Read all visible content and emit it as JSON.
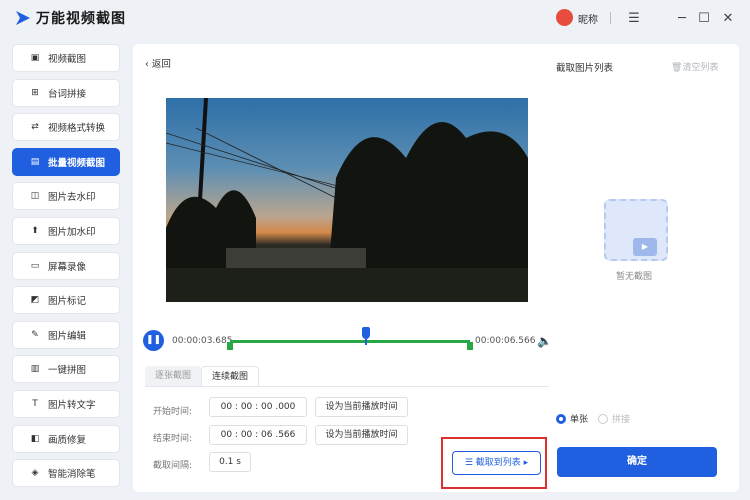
{
  "app": {
    "title": "万能视频截图",
    "user": "昵称",
    "avatar_text": ""
  },
  "window_controls": [
    "☰",
    "─",
    "☐",
    "✕"
  ],
  "sidebar": {
    "items": [
      {
        "label": "视频截图",
        "icon": "image-icon",
        "glyph": "▣",
        "active": false
      },
      {
        "label": "台词拼接",
        "icon": "dialogue-icon",
        "glyph": "⊞",
        "active": false
      },
      {
        "label": "视频格式转换",
        "icon": "convert-icon",
        "glyph": "⇄",
        "active": false
      },
      {
        "label": "批量视频截图",
        "icon": "batch-icon",
        "glyph": "▤",
        "active": true
      },
      {
        "label": "图片去水印",
        "icon": "remove-watermark-icon",
        "glyph": "◫",
        "active": false
      },
      {
        "label": "图片加水印",
        "icon": "add-watermark-icon",
        "glyph": "⬆",
        "active": false
      },
      {
        "label": "屏幕录像",
        "icon": "screen-record-icon",
        "glyph": "▭",
        "active": false
      },
      {
        "label": "图片标记",
        "icon": "mark-icon",
        "glyph": "◩",
        "active": false
      },
      {
        "label": "图片编辑",
        "icon": "edit-icon",
        "glyph": "✎",
        "active": false
      },
      {
        "label": "一键拼图",
        "icon": "collage-icon",
        "glyph": "▥",
        "active": false
      },
      {
        "label": "图片转文字",
        "icon": "text-icon",
        "glyph": "T",
        "active": false
      },
      {
        "label": "画质修复",
        "icon": "restore-icon",
        "glyph": "◧",
        "active": false
      },
      {
        "label": "智能消除笔",
        "icon": "eraser-icon",
        "glyph": "◈",
        "active": false
      }
    ]
  },
  "main": {
    "back_label": "返回",
    "list_title": "截取图片列表",
    "clear_list": "清空列表",
    "empty_text": "暂无截图",
    "player": {
      "current_time": "00:00:03.685",
      "end_time": "00:00:06.566"
    },
    "tabs": [
      {
        "label": "逐张截图",
        "active": false
      },
      {
        "label": "连续截图",
        "active": true
      }
    ],
    "form": {
      "start_label": "开始时间:",
      "start_value": "00 : 00 : 00 .000",
      "end_label": "结束时间:",
      "end_value": "00 : 00 : 06 .566",
      "interval_label": "截取间隔:",
      "interval_value": "0.1  s",
      "set_current_label": "设为当前播放时间"
    },
    "capture_button": "截取到列表 ▸",
    "mode_options": [
      {
        "label": "单张",
        "selected": true
      },
      {
        "label": "拼接",
        "selected": false
      }
    ],
    "confirm_button": "确定"
  }
}
